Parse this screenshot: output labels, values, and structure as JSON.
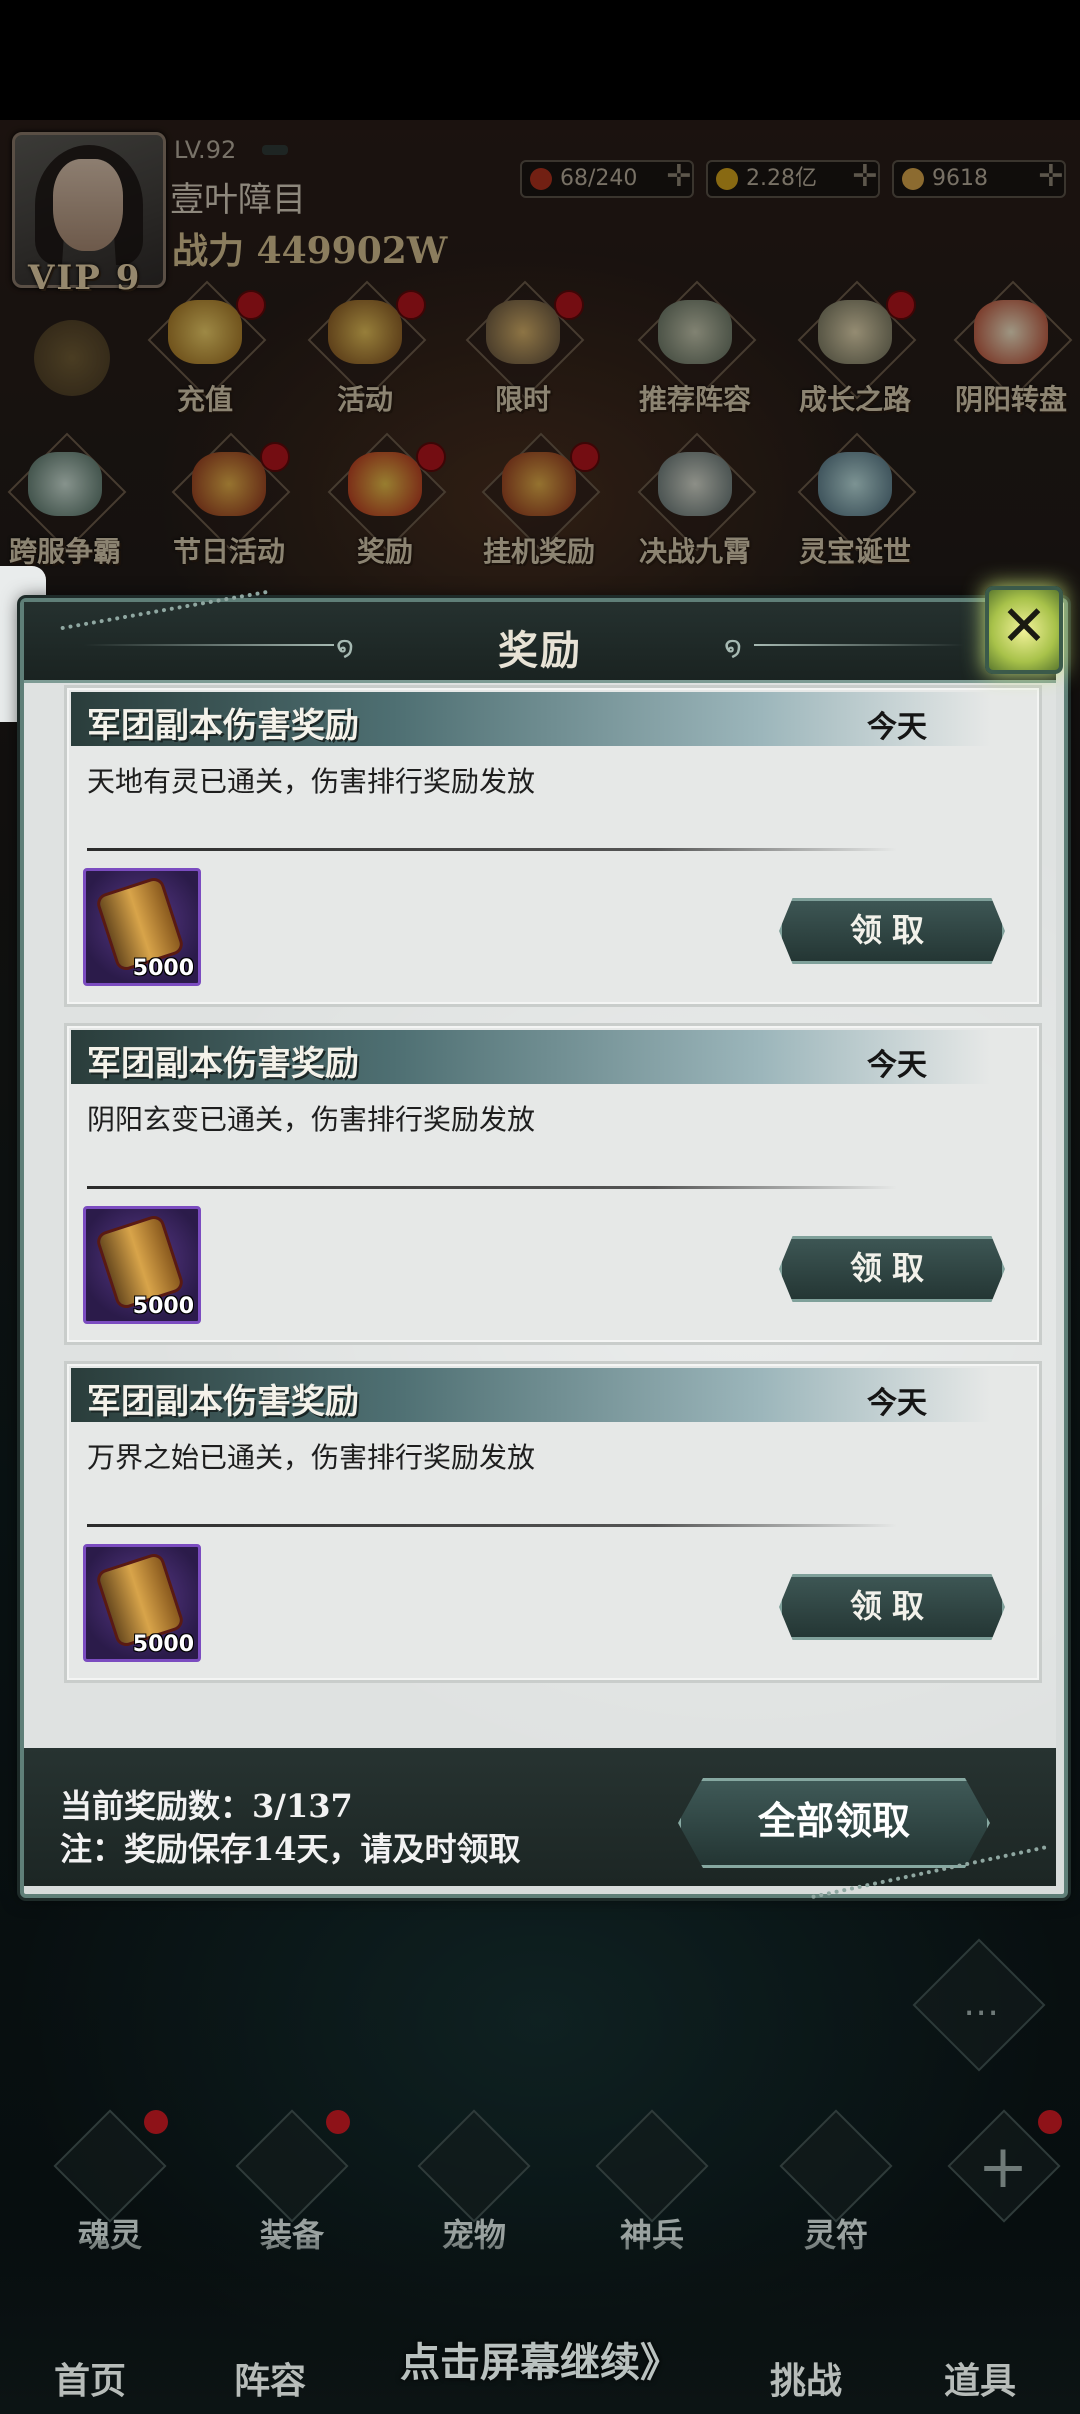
{
  "player": {
    "level": "LV.92",
    "name": "壹叶障目",
    "power": "战力 449902W",
    "vip": "VIP 9"
  },
  "resources": [
    {
      "icon": "stamina-icon",
      "value": "68/240",
      "color": "#b0321e"
    },
    {
      "icon": "coin-icon",
      "value": "2.28亿",
      "color": "#d1a11c"
    },
    {
      "icon": "ingot-icon",
      "value": "9618",
      "color": "#d7a54a"
    }
  ],
  "activities_row1": [
    "充值",
    "活动",
    "限时",
    "推荐阵容",
    "成长之路",
    "阴阳转盘"
  ],
  "activities_row2": [
    "跨服争霸",
    "节日活动",
    "奖励",
    "挂机奖励",
    "决战九霄",
    "灵宝诞世"
  ],
  "dialog": {
    "title": "奖励",
    "cards": [
      {
        "title": "军团副本伤害奖励",
        "date": "今天",
        "desc": "天地有灵已通关，伤害排行奖励发放",
        "item_qty": "5000",
        "button": "领取"
      },
      {
        "title": "军团副本伤害奖励",
        "date": "今天",
        "desc": "阴阳玄变已通关，伤害排行奖励发放",
        "item_qty": "5000",
        "button": "领取"
      },
      {
        "title": "军团副本伤害奖励",
        "date": "今天",
        "desc": "万界之始已通关，伤害排行奖励发放",
        "item_qty": "5000",
        "button": "领取"
      }
    ],
    "reward_count": "当前奖励数：3/137",
    "note": "注：奖励保存14天，请及时领取",
    "claim_all": "全部领取"
  },
  "sub_menu": [
    "魂灵",
    "装备",
    "宠物",
    "神兵",
    "灵符"
  ],
  "nav": [
    "首页",
    "阵容",
    "挑战",
    "道具"
  ],
  "hint": "点击屏幕继续》",
  "colors": {
    "panel": "#dfe2e1",
    "header": "#1f2a28",
    "accent": "#7fa09a",
    "badge": "#b3141c"
  }
}
